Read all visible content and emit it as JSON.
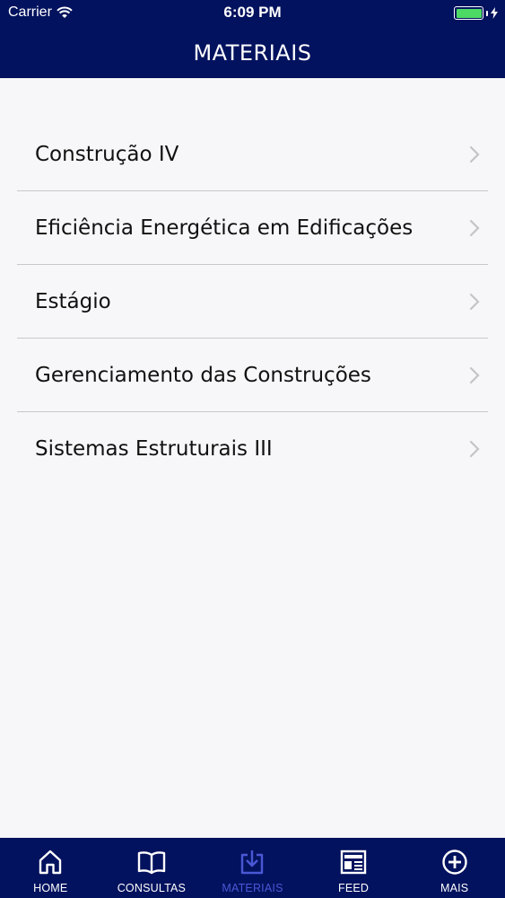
{
  "status": {
    "carrier": "Carrier",
    "time": "6:09 PM"
  },
  "header": {
    "title": "MATERIAIS"
  },
  "list": {
    "items": [
      {
        "label": "Construção IV"
      },
      {
        "label": "Eficiência Energética em Edificações"
      },
      {
        "label": "Estágio"
      },
      {
        "label": "Gerenciamento das Construções"
      },
      {
        "label": "Sistemas Estruturais III"
      }
    ]
  },
  "tabs": [
    {
      "label": "HOME",
      "icon": "home-icon"
    },
    {
      "label": "CONSULTAS",
      "icon": "book-icon"
    },
    {
      "label": "MATERIAIS",
      "icon": "download-icon",
      "active": true
    },
    {
      "label": "FEED",
      "icon": "newspaper-icon"
    },
    {
      "label": "MAIS",
      "icon": "plus-circle-icon"
    }
  ],
  "colors": {
    "bar_background": "#03125e",
    "active_tab": "#4a57d6",
    "battery": "#4cd964"
  }
}
